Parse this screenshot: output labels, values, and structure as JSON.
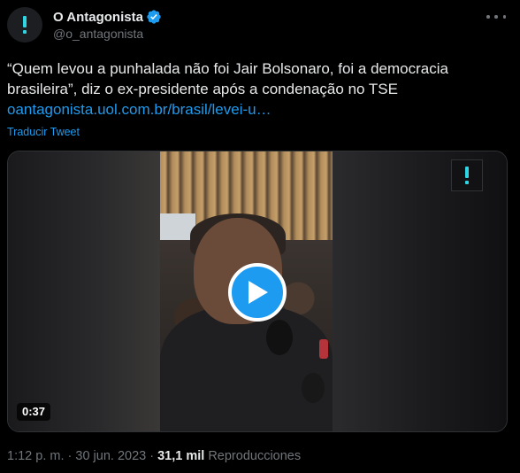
{
  "author": {
    "display_name": "O Antagonista",
    "handle": "@o_antagonista",
    "verified": true,
    "avatar_icon": "exclamation-logo-icon",
    "accent_color": "#2fd5e3"
  },
  "tweet": {
    "text": "“Quem levou a punhalada não foi Jair Bolsonaro, foi a democracia brasileira”, diz o ex-presidente após a condenação no TSE",
    "link": "oantagonista.uol.com.br/brasil/levei-u…",
    "translate_label": "Traducir Tweet"
  },
  "media": {
    "type": "video",
    "duration": "0:37",
    "play_icon": "play-icon",
    "watermark_icon": "exclamation-logo-icon"
  },
  "meta": {
    "time": "1:12 p. m.",
    "separator1": " · ",
    "date": "30 jun. 2023",
    "separator2": " · ",
    "views_count": "31,1 mil",
    "views_label": "Reproducciones"
  },
  "colors": {
    "background": "#000000",
    "text": "#e7e9ea",
    "secondary": "#71767b",
    "link": "#1d9bf0"
  }
}
